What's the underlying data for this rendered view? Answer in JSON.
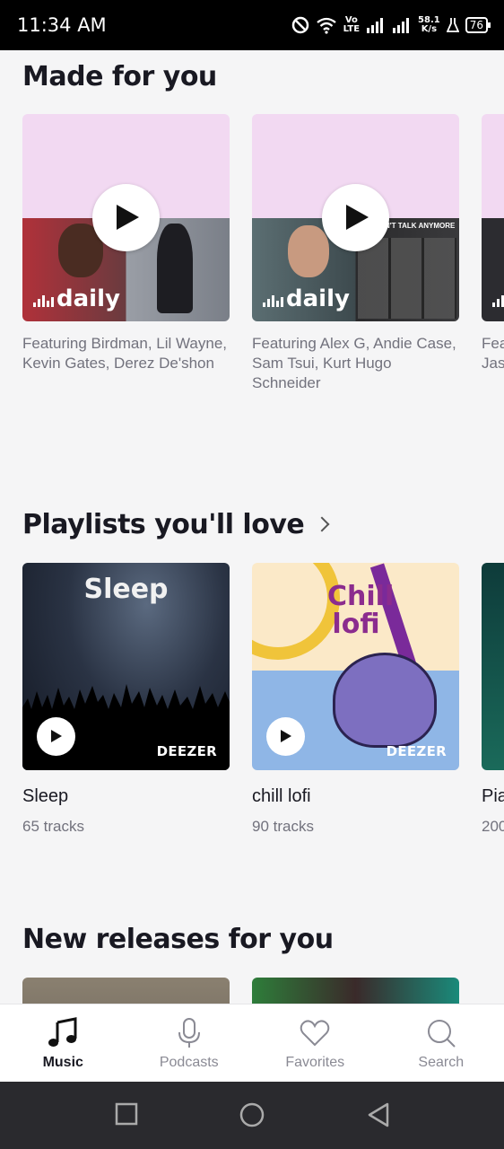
{
  "status": {
    "time": "11:34 AM",
    "network_top": "Vo",
    "network_bottom": "LTE",
    "speed_top": "58.1",
    "speed_bottom": "K/s",
    "battery": "76"
  },
  "sections": {
    "made_for_you": {
      "title": "Made for you",
      "cards": [
        {
          "label": "daily",
          "subtitle": "Featuring Birdman, Lil Wayne, Kevin Gates, Derez De'shon"
        },
        {
          "label": "daily",
          "subtitle": "Featuring Alex G, Andie Case, Sam Tsui, Kurt Hugo Schneider",
          "art_text": "N'T TALK ANYMORE"
        },
        {
          "subtitle": "Fea Jas"
        }
      ]
    },
    "playlists": {
      "title": "Playlists you'll love",
      "cards": [
        {
          "art_title": "Sleep",
          "brand": "DEEZER",
          "title": "Sleep",
          "tracks": "65 tracks"
        },
        {
          "art_title": "Chill lofi",
          "brand": "DEEZER",
          "title": "chill lofi",
          "tracks": "90 tracks"
        },
        {
          "title": "Pia",
          "tracks": "200"
        }
      ]
    },
    "new_releases": {
      "title": "New releases for you"
    }
  },
  "bottom_nav": [
    {
      "label": "Music",
      "icon": "music-note-icon",
      "active": true
    },
    {
      "label": "Podcasts",
      "icon": "microphone-icon",
      "active": false
    },
    {
      "label": "Favorites",
      "icon": "heart-icon",
      "active": false
    },
    {
      "label": "Search",
      "icon": "search-icon",
      "active": false
    }
  ],
  "colors": {
    "mix_pink": "#f2d9f2",
    "background": "#f5f5f6",
    "sleep_bg": "#1a2332",
    "lofi_purple": "#8b2c8e"
  }
}
